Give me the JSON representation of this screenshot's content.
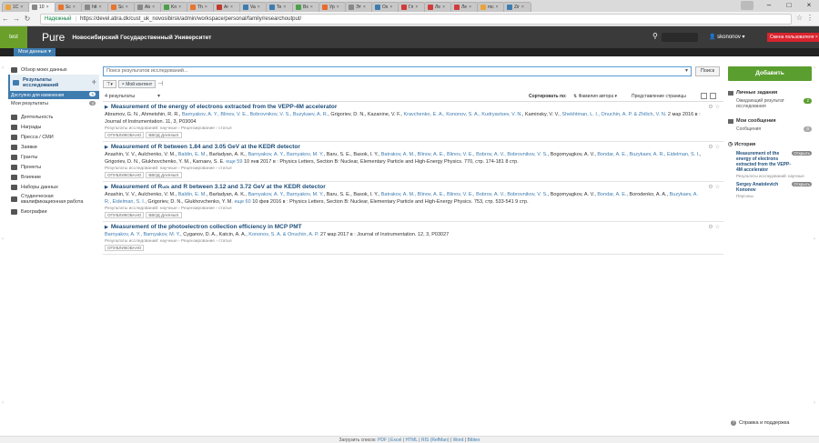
{
  "browser": {
    "tabs": [
      {
        "title": "1C",
        "color": "#e8a33d"
      },
      {
        "title": "10",
        "color": "#888888"
      },
      {
        "title": "Sc",
        "color": "#e8742e"
      },
      {
        "title": "htt",
        "color": "#888888"
      },
      {
        "title": "Sc",
        "color": "#e8742e"
      },
      {
        "title": "Ab",
        "color": "#888888"
      },
      {
        "title": "Kn",
        "color": "#4aa14a"
      },
      {
        "title": "Th",
        "color": "#e8742e"
      },
      {
        "title": "Ar",
        "color": "#c0392b"
      },
      {
        "title": "Va",
        "color": "#3e7cb0"
      },
      {
        "title": "Te",
        "color": "#3e7cb0"
      },
      {
        "title": "Bx",
        "color": "#4aa14a"
      },
      {
        "title": "Ур",
        "color": "#e86a2e"
      },
      {
        "title": "Эт",
        "color": "#888888"
      },
      {
        "title": "Ох",
        "color": "#3e7cb0"
      },
      {
        "title": "Гл",
        "color": "#d13b3b"
      },
      {
        "title": "Ле",
        "color": "#d13b3b"
      },
      {
        "title": "Ле",
        "color": "#d13b3b"
      },
      {
        "title": "mc",
        "color": "#e8a33d"
      },
      {
        "title": "Zir",
        "color": "#3e7cb0"
      }
    ],
    "secure_label": "Надежный",
    "url": "https://devel.atira.dk/cust_uk_novosibirsk/admin/workspace/personal/family/researchoutput/"
  },
  "header": {
    "env_badge": "test",
    "logo": "Pure",
    "university": "Новосибирский Государственный Университет",
    "user": "skononov",
    "change_user": "Смена пользователя",
    "my_data": "Мои данные"
  },
  "sidebar": {
    "overview": "Обзор моих данных",
    "research": "Результаты исследований",
    "available": "Доступно для изменения",
    "available_count": "5",
    "my_results": "Мои результаты",
    "my_results_count": "4",
    "items": [
      "Деятельность",
      "Награды",
      "Пресса / СМИ",
      "Заявки",
      "Гранты",
      "Проекты",
      "Влияние",
      "Наборы данных",
      "Студенческая квалификационная работа",
      "Биографии"
    ]
  },
  "main": {
    "search_placeholder": "Поиск результатов исследований...",
    "search_button": "Поиск",
    "filter_icon": "filter-icon",
    "filter_chip": "Мой контент",
    "results_count": "4 результаты",
    "sort_label": "Сортировать по:",
    "sort_value": "Фамилия автора",
    "view_label": "Представление страницы",
    "results": [
      {
        "title": "Measurement of the energy of electrons extracted from the VEPP-4M accelerator",
        "authors": [
          {
            "t": "Abramov, G. N., Ahmetshin, R. R., ",
            "link": false
          },
          {
            "t": "Barnyakov, A. Y., Blinov, V. E., Bobrovnikov, V. S., Buzykaev, A. R.",
            "link": true
          },
          {
            "t": ", Grigoriev, D. N., Kazanine, V. F., ",
            "link": false
          },
          {
            "t": "Kravchenko, E. A., Kononov, S. A., Kudryavtsev, V. N.",
            "link": true
          },
          {
            "t": ", Kaminsky, V. V., ",
            "link": false
          },
          {
            "t": "Shekhtman, L. I., Onuchin, A. P. & Zhilich, V. N.",
            "link": true
          },
          {
            "t": " 2 мар 2016 в : Journal of Instrumentation. 11, 3, P03004",
            "link": false
          }
        ],
        "meta": "Результаты исследований: научные › Рецензирование › статья",
        "badges": [
          "ОПУБЛИКОВАНО",
          "ВВОД ДАННЫХ"
        ]
      },
      {
        "title": "Measurement of R between 1.84 and 3.05 GeV at the KEDR detector",
        "authors": [
          {
            "t": "Anashin, V. V., Aulchenko, V. M., ",
            "link": false
          },
          {
            "t": "Baldin, E. M.",
            "link": true
          },
          {
            "t": ", Barladyan, A. K., ",
            "link": false
          },
          {
            "t": "Barnyakov, A. Y., Barnyakov, M. Y.",
            "link": true
          },
          {
            "t": ", Baru, S. E., Basok, I. Y., ",
            "link": false
          },
          {
            "t": "Batrakov, A. M., Blinov, A. E., Blinov, V. E., Bobrov, A. V., Bobrovnikov, V. S.",
            "link": true
          },
          {
            "t": ", Bogomyagkov, A. V., ",
            "link": false
          },
          {
            "t": "Bondar, A. E., Buzykaev, A. R., Eidelman, S. I.",
            "link": true
          },
          {
            "t": ", Grigoriev, D. N., Glukhovchenko, Y. M., Karnaev, S. E. ",
            "link": false
          },
          {
            "t": "еще 59",
            "link": true
          },
          {
            "t": " 10 янв 2017 в : Physics Letters, Section B: Nuclear, Elementary Particle and High-Energy Physics. 770, стр. 174-181 8 стр.",
            "link": false
          }
        ],
        "meta": "Результаты исследований: научные › Рецензирование › статья",
        "badges": [
          "ОПУБЛИКОВАНО",
          "ВВОД ДАННЫХ"
        ]
      },
      {
        "title": "Measurement of R",
        "title_sub": "uds",
        "title_rest": " and R between 3.12 and 3.72 GeV at the KEDR detector",
        "authors": [
          {
            "t": "Anashin, V. V., Aulchenko, V. M., ",
            "link": false
          },
          {
            "t": "Baldin, E. M.",
            "link": true
          },
          {
            "t": ", Barladyan, A. K., ",
            "link": false
          },
          {
            "t": "Barnyakov, A. Y., Barnyakov, M. Y.",
            "link": true
          },
          {
            "t": ", Baru, S. E., Basok, I. Y., ",
            "link": false
          },
          {
            "t": "Batrakov, A. M., Blinov, A. E., Blinov, V. E., Bobrov, A. V., Bobrovnikov, V. S.",
            "link": true
          },
          {
            "t": ", Bogomyagkov, A. V., ",
            "link": false
          },
          {
            "t": "Bondar, A. E.",
            "link": true
          },
          {
            "t": ", Borodenko, A. A., ",
            "link": false
          },
          {
            "t": "Buzykaev, A. R., Eidelman, S. I.",
            "link": true
          },
          {
            "t": ", Grigoriev, D. N., Glukhovchenko, Y. M. ",
            "link": false
          },
          {
            "t": "еще 60",
            "link": true
          },
          {
            "t": " 10 фев 2016 в : Physics Letters, Section B: Nuclear, Elementary Particle and High-Energy Physics. 753, стр. 533-541 9 стр.",
            "link": false
          }
        ],
        "meta": "Результаты исследований: научные › Рецензирование › статья",
        "badges": [
          "ОПУБЛИКОВАНО",
          "ВВОД ДАННЫХ"
        ]
      },
      {
        "title": "Measurement of the photoelectron collection efficiency in MCP PMT",
        "authors": [
          {
            "t": "Barnyakov, A. Y., Barnyakov, M. Y.",
            "link": true
          },
          {
            "t": ", Cyganov, D. A., Katcin, A. A., ",
            "link": false
          },
          {
            "t": "Kononov, S. A. & Onuchin, A. P.",
            "link": true
          },
          {
            "t": " 27 мар 2017 в : Journal of Instrumentation. 12, 3, P03027",
            "link": false
          }
        ],
        "meta": "Результаты исследований: научные › Рецензирование › статья",
        "badges": [
          "ОПУБЛИКОВАНО"
        ]
      }
    ]
  },
  "right": {
    "add_button": "Добавить",
    "tasks_title": "Личные задания",
    "tasks_row": "Ожидающий результат исследования",
    "tasks_count": "2",
    "messages_title": "Мои сообщения",
    "messages_row": "Сообщения",
    "messages_count": "0",
    "history_title": "История",
    "history": [
      {
        "title": "Measurement of the energy of electrons extracted from the VEPP-4M accelerator",
        "badge": "Открыть",
        "sub": "Результаты исследований: научные"
      },
      {
        "title": "Sergey Anatolevich Kononov",
        "badge": "Открыть",
        "sub": "Персоны"
      }
    ],
    "help": "Справка и поддержка"
  },
  "footer": {
    "prefix": "Загрузить список:",
    "links": [
      "PDF",
      "Excel",
      "HTML",
      "RIS (RefMan)",
      "Word",
      "Bibtex"
    ]
  },
  "colors": {
    "accent": "#3e7cb0",
    "add_green": "#5a9e2f",
    "change_user_red": "#d9232d",
    "header_dark": "#3a3a3a"
  }
}
